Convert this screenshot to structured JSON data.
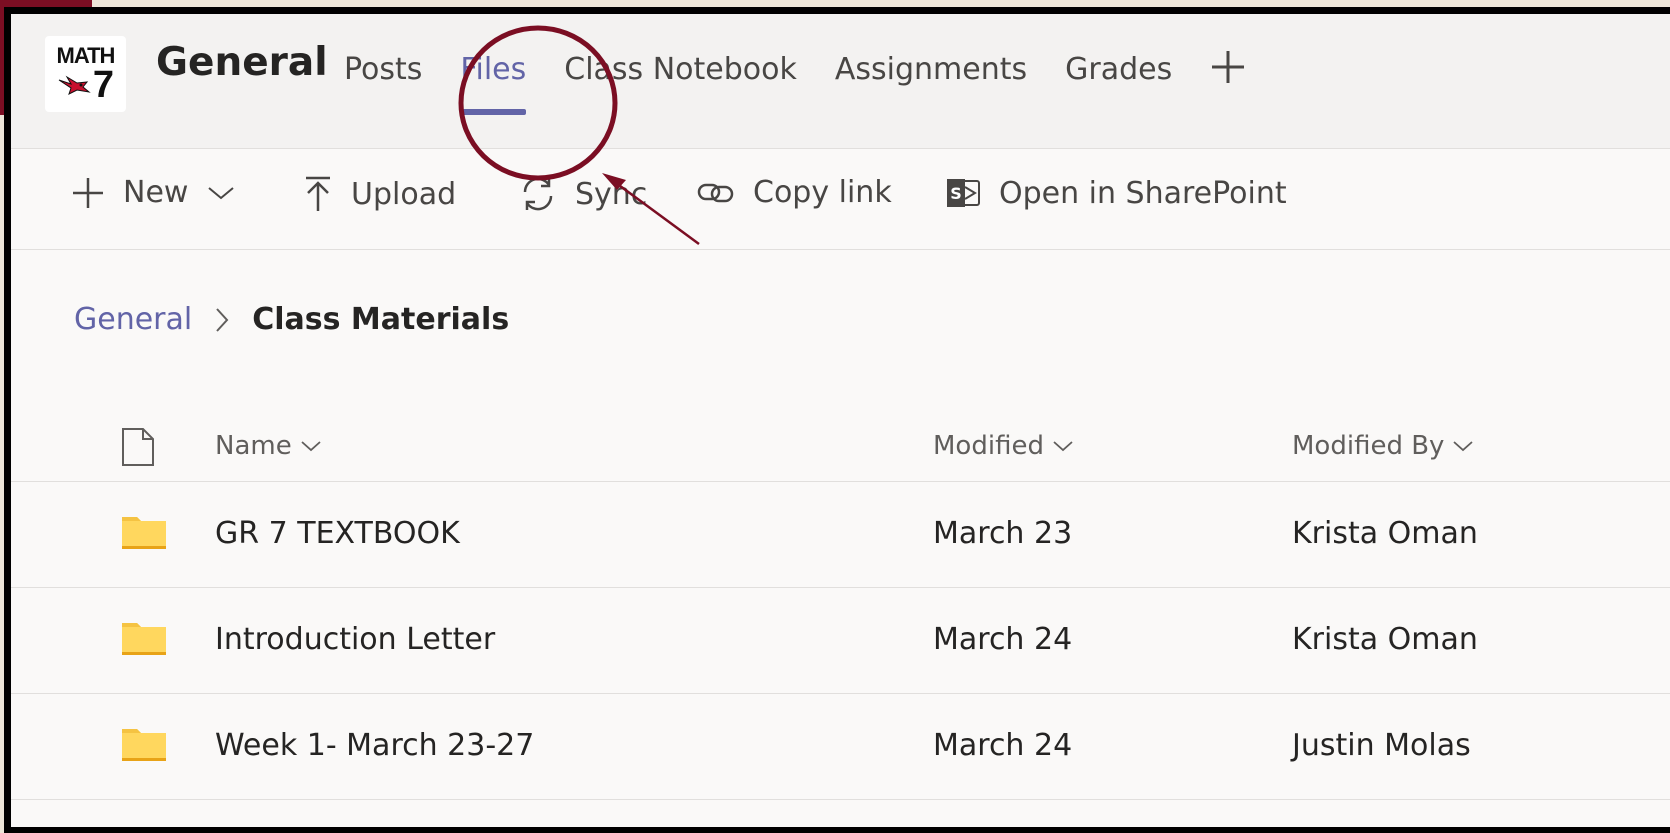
{
  "team_logo": {
    "line1": "MATH",
    "line2": "7"
  },
  "channel": {
    "title": "General"
  },
  "tabs": [
    {
      "label": "Posts"
    },
    {
      "label": "Files"
    },
    {
      "label": "Class Notebook"
    },
    {
      "label": "Assignments"
    },
    {
      "label": "Grades"
    }
  ],
  "active_tab": "Files",
  "toolbar": {
    "new_label": "New",
    "upload_label": "Upload",
    "sync_label": "Sync",
    "copy_link_label": "Copy link",
    "sharepoint_label": "Open in SharePoint"
  },
  "breadcrumb": {
    "root": "General",
    "current": "Class Materials"
  },
  "columns": {
    "name": "Name",
    "modified": "Modified",
    "modified_by": "Modified By"
  },
  "rows": [
    {
      "name": "GR 7 TEXTBOOK",
      "modified": "March 23",
      "modified_by": "Krista Oman"
    },
    {
      "name": "Introduction Letter",
      "modified": "March 24",
      "modified_by": "Krista Oman"
    },
    {
      "name": "Week 1- March 23-27",
      "modified": "March 24",
      "modified_by": "Justin Molas"
    }
  ],
  "colors": {
    "accent": "#6264a7",
    "annotation": "#7b0e23",
    "folder": "#ffd75e"
  },
  "icons": [
    "plus-icon",
    "chevron-down-icon",
    "upload-icon",
    "sync-icon",
    "link-icon",
    "sharepoint-icon",
    "file-icon",
    "folder-icon"
  ]
}
